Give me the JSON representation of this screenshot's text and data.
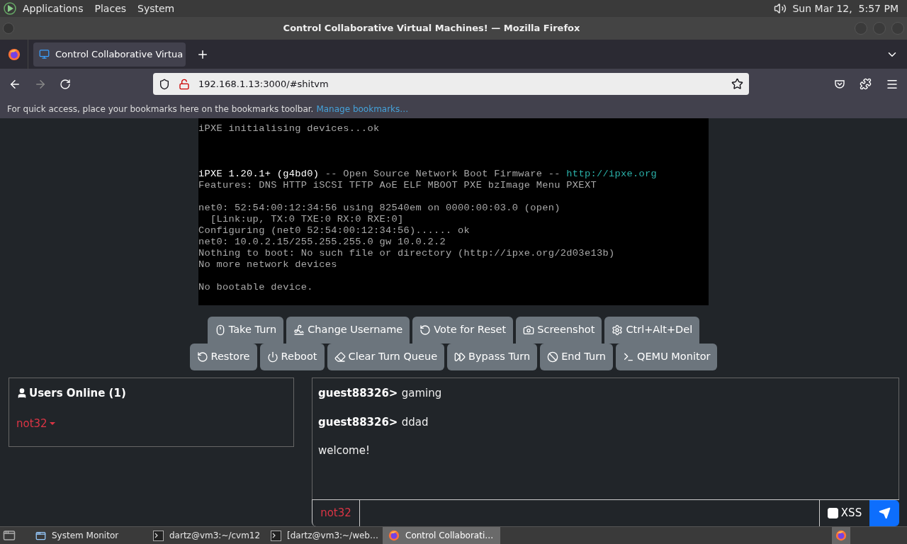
{
  "top_panel": {
    "menus": [
      "Applications",
      "Places",
      "System"
    ],
    "clock": "Sun Mar 12,  5:57 PM"
  },
  "window": {
    "title": "Control Collaborative Virtual Machines! — Mozilla Firefox"
  },
  "tabs": [
    {
      "label": "Control Collaborative Virtua",
      "selected": true
    }
  ],
  "address_bar": {
    "url": "192.168.1.13:3000/#shitvm"
  },
  "bookmarks_bar": {
    "message": "For quick access, place your bookmarks here on the bookmarks toolbar.",
    "link": "Manage bookmarks…"
  },
  "vm_screen": {
    "lines": [
      {
        "segments": [
          {
            "text": "iPXE initialising devices...ok",
            "kind": "normal"
          }
        ]
      },
      {
        "kind": "blank"
      },
      {
        "kind": "blank"
      },
      {
        "kind": "blank"
      },
      {
        "segments": [
          {
            "text": "iPXE 1.20.1+ (g4bd0)",
            "kind": "bright"
          },
          {
            "text": " -- Open Source Network Boot Firmware -- ",
            "kind": "normal"
          },
          {
            "text": "http://ipxe.org",
            "kind": "link"
          }
        ]
      },
      {
        "segments": [
          {
            "text": "Features: DNS HTTP iSCSI TFTP AoE ELF MBOOT PXE bzImage Menu PXEXT",
            "kind": "normal"
          }
        ]
      },
      {
        "kind": "blank"
      },
      {
        "segments": [
          {
            "text": "net0: 52:54:00:12:34:56 using 82540em on 0000:00:03.0 (open)",
            "kind": "normal"
          }
        ]
      },
      {
        "segments": [
          {
            "text": "  [Link:up, TX:0 TXE:0 RX:0 RXE:0]",
            "kind": "normal"
          }
        ]
      },
      {
        "segments": [
          {
            "text": "Configuring (net0 52:54:00:12:34:56)...... ok",
            "kind": "normal"
          }
        ]
      },
      {
        "segments": [
          {
            "text": "net0: 10.0.2.15/255.255.255.0 gw 10.0.2.2",
            "kind": "normal"
          }
        ]
      },
      {
        "segments": [
          {
            "text": "Nothing to boot: No such file or directory (http://ipxe.org/2d03e13b)",
            "kind": "normal"
          }
        ]
      },
      {
        "segments": [
          {
            "text": "No more network devices",
            "kind": "normal"
          }
        ]
      },
      {
        "kind": "blank"
      },
      {
        "segments": [
          {
            "text": "No bootable device.",
            "kind": "normal"
          }
        ]
      }
    ]
  },
  "vm_buttons": [
    [
      {
        "label": "Take Turn",
        "kind": "mouse"
      },
      {
        "label": "Change Username",
        "kind": "signature"
      },
      {
        "label": "Vote for Reset",
        "kind": "undo"
      },
      {
        "label": "Screenshot",
        "kind": "camera"
      },
      {
        "label": "Ctrl+Alt+Del",
        "kind": "gear"
      }
    ],
    [
      {
        "label": "Restore",
        "kind": "undo"
      },
      {
        "label": "Reboot",
        "kind": "power"
      },
      {
        "label": "Clear Turn Queue",
        "kind": "eraser"
      },
      {
        "label": "Bypass Turn",
        "kind": "forward"
      },
      {
        "label": "End Turn",
        "kind": "ban"
      },
      {
        "label": "QEMU Monitor",
        "kind": "terminal"
      }
    ]
  ],
  "users_panel": {
    "title": "Users Online (1)",
    "users": [
      {
        "name": "not32",
        "color": "#dc3545"
      }
    ]
  },
  "chat": {
    "messages": [
      {
        "user": "guest88326>",
        "text": "gaming"
      },
      {
        "user": "guest88326>",
        "text": "ddad"
      },
      {
        "text": "welcome!"
      }
    ],
    "username": "not32",
    "xss": {
      "label": "XSS",
      "checked": false
    }
  },
  "taskbar": {
    "items": [
      {
        "label": "System Monitor",
        "kind": "window",
        "selected": false
      },
      {
        "label": "dartz@vm3:~/cvm12",
        "kind": "terminal",
        "selected": false
      },
      {
        "label": "[dartz@vm3:~/web…",
        "kind": "terminal",
        "selected": false
      },
      {
        "label": "Control Collaborati…",
        "kind": "browser",
        "selected": true
      }
    ]
  }
}
